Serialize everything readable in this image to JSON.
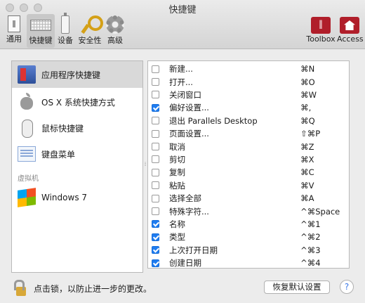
{
  "window": {
    "title": "快捷键"
  },
  "toolbar": {
    "items": [
      {
        "label": "通用",
        "icon": "switch-icon"
      },
      {
        "label": "快捷键",
        "icon": "keyboard-icon",
        "selected": true
      },
      {
        "label": "设备",
        "icon": "device-icon"
      },
      {
        "label": "安全性",
        "icon": "key-icon"
      },
      {
        "label": "高级",
        "icon": "gear-icon"
      },
      {
        "label": "Toolbox",
        "icon": "toolbox-icon"
      },
      {
        "label": "Access",
        "icon": "access-icon"
      }
    ]
  },
  "sidebar": {
    "items": [
      {
        "label": "应用程序快捷键",
        "icon": "app-shortcuts-icon",
        "selected": true
      },
      {
        "label": "OS X 系统快捷方式",
        "icon": "apple-icon"
      },
      {
        "label": "鼠标快捷键",
        "icon": "mouse-icon"
      },
      {
        "label": "键盘菜单",
        "icon": "keyboard-menu-icon"
      }
    ],
    "group_label": "虚拟机",
    "vm_items": [
      {
        "label": "Windows 7",
        "icon": "windows-icon"
      }
    ]
  },
  "shortcuts": [
    {
      "name": "新建...",
      "key": "⌘N",
      "checked": false
    },
    {
      "name": "打开...",
      "key": "⌘O",
      "checked": false
    },
    {
      "name": "关闭窗口",
      "key": "⌘W",
      "checked": false
    },
    {
      "name": "偏好设置...",
      "key": "⌘,",
      "checked": true
    },
    {
      "name": "退出 Parallels Desktop",
      "key": "⌘Q",
      "checked": false
    },
    {
      "name": "页面设置...",
      "key": "⇧⌘P",
      "checked": false
    },
    {
      "name": "取消",
      "key": "⌘Z",
      "checked": false
    },
    {
      "name": "剪切",
      "key": "⌘X",
      "checked": false
    },
    {
      "name": "复制",
      "key": "⌘C",
      "checked": false
    },
    {
      "name": "粘贴",
      "key": "⌘V",
      "checked": false
    },
    {
      "name": "选择全部",
      "key": "⌘A",
      "checked": false
    },
    {
      "name": "特殊字符...",
      "key": "^⌘Space",
      "checked": false
    },
    {
      "name": "名称",
      "key": "^⌘1",
      "checked": true
    },
    {
      "name": "类型",
      "key": "^⌘2",
      "checked": true
    },
    {
      "name": "上次打开日期",
      "key": "^⌘3",
      "checked": true
    },
    {
      "name": "创建日期",
      "key": "^⌘4",
      "checked": true
    }
  ],
  "footer": {
    "lock_text": "点击锁，以防止进一步的更改。",
    "restore_label": "恢复默认设置",
    "help_label": "?"
  }
}
